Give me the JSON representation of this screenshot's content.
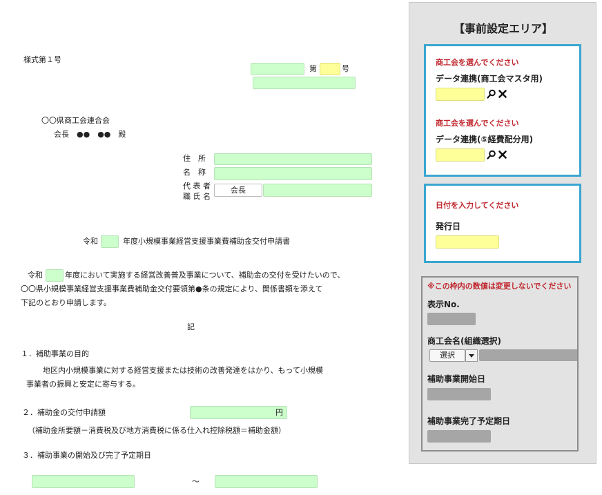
{
  "form": {
    "form_no": "様式第１号",
    "dai": "第",
    "go": "号",
    "addressee_org": "〇〇県商工会連合会",
    "addressee_person": "会長　●●　●●　殿",
    "applicant": {
      "address_label": "住　所",
      "name_label": "名　称",
      "rep_label_line1": "代 表 者",
      "rep_label_line2": "職 氏 名",
      "rep_title_value": "会長"
    },
    "title_prefix": "令和",
    "title_suffix": "年度小規模事業経営支援事業費補助金交付申請書",
    "body_line1_prefix": "令和",
    "body_line1_suffix": "年度において実施する経営改善普及事業について、補助金の交付を受けたいので、",
    "body_line2": "〇〇県小規模事業経営支援事業費補助金交付要領第●条の規定により、関係書類を添えて",
    "body_line3": "下記のとおり申請します。",
    "ki": "記",
    "section1_title": "１．補助事業の目的",
    "section1_body_line1": "地区内小規模事業に対する経営支援または技術の改善発達をはかり、もって小規模",
    "section1_body_line2": "事業者の振興と安定に寄与する。",
    "section2_title": "２．補助金の交付申請額",
    "yen": "円",
    "section2_note": "（補助金所要額－消費税及び地方消費税に係る仕入れ控除税額＝補助金額）",
    "section3_title": "３．補助事業の開始及び完了予定期日",
    "tilde": "～"
  },
  "panel": {
    "title": "【事前設定エリア】",
    "box1": {
      "prompt1": "商工会を選んでください",
      "label1": "データ連携(商工会マスタ用)",
      "prompt2": "商工会を選んでください",
      "label2": "データ連携(⑤経費配分用)"
    },
    "box2": {
      "prompt": "日付を入力してください",
      "label": "発行日"
    },
    "box3": {
      "warning": "※この枠内の数値は変更しないでください",
      "display_no_label": "表示No.",
      "org_name_label": "商工会名(組織選択)",
      "select_label": "選択",
      "start_date_label": "補助事業開始日",
      "end_date_label": "補助事業完了予定期日"
    }
  },
  "colors": {
    "green_field": "#ccffcc",
    "yellow_field": "#ffff99",
    "blue_border": "#3aa6d0",
    "red_text": "#c0262d",
    "panel_bg": "#e3e3e3"
  },
  "icons": [
    "search-icon",
    "close-icon",
    "chevron-down-icon"
  ]
}
